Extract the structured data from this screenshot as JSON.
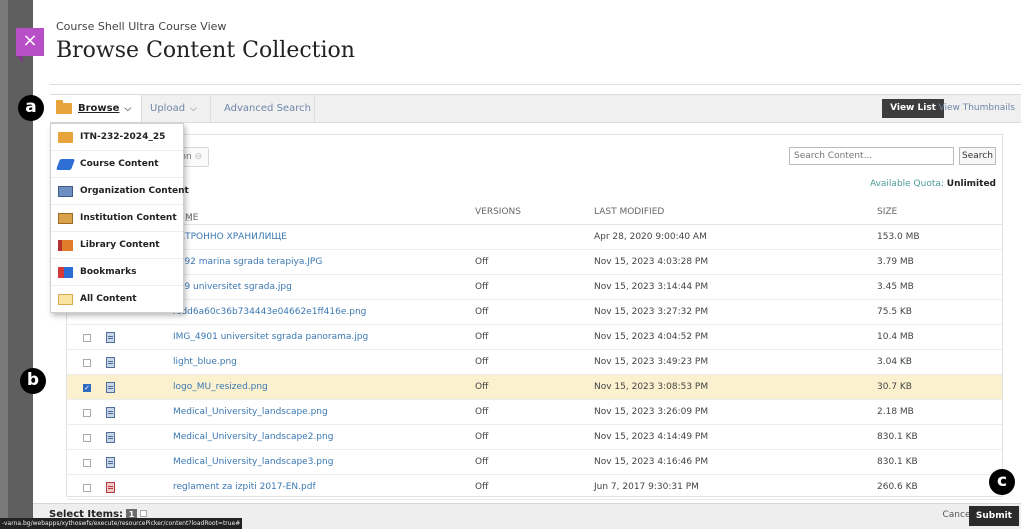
{
  "header": {
    "breadcrumb": "Course Shell Ultra Course View",
    "title": "Browse Content Collection",
    "close_glyph": "×"
  },
  "toolbar": {
    "browse_label": "Browse",
    "upload_label": "Upload",
    "advanced_search_label": "Advanced Search",
    "view_list_label": "View List",
    "view_thumbnails_label": "View Thumbnails"
  },
  "browse_menu": {
    "items": [
      {
        "label": "ITN-232-2024_25",
        "icon": "folder-icon"
      },
      {
        "label": "Course Content",
        "icon": "course-content-icon"
      },
      {
        "label": "Organization Content",
        "icon": "organization-content-icon"
      },
      {
        "label": "Institution Content",
        "icon": "institution-content-icon"
      },
      {
        "label": "Library Content",
        "icon": "library-content-icon"
      },
      {
        "label": "Bookmarks",
        "icon": "bookmarks-icon"
      },
      {
        "label": "All Content",
        "icon": "all-content-icon"
      }
    ]
  },
  "panel": {
    "collection_tab_fragment": "ition",
    "search_placeholder": "Search Content...",
    "search_button": "Search",
    "quota_label": "Available Quota:",
    "quota_value": "Unlimited",
    "columns": {
      "name": "ME",
      "name_sort_glyph": "△",
      "versions": "VERSIONS",
      "last_modified": "LAST MODIFIED",
      "size": "SIZE"
    },
    "rows": [
      {
        "name": "ЕКТРОННО ХРАНИЛИЩЕ",
        "versions": "",
        "modified": "Apr 28, 2020 9:00:40 AM",
        "size": "153.0 MB"
      },
      {
        "name": "7992 marina sgrada terapiya.JPG",
        "versions": "Off",
        "modified": "Nov 15, 2023 4:03:28 PM",
        "size": "3.79 MB"
      },
      {
        "name": "759 universitet sgrada.jpg",
        "versions": "Off",
        "modified": "Nov 15, 2023 3:14:44 PM",
        "size": "3.45 MB"
      },
      {
        "name": "rcdd6a60c36b734443e04662e1ff416e.png",
        "versions": "Off",
        "modified": "Nov 15, 2023 3:27:32 PM",
        "size": "75.5 KB"
      },
      {
        "name": "IMG_4901 universitet sgrada panorama.jpg",
        "versions": "Off",
        "modified": "Nov 15, 2023 4:04:52 PM",
        "size": "10.4 MB"
      },
      {
        "name": "light_blue.png",
        "versions": "Off",
        "modified": "Nov 15, 2023 3:49:23 PM",
        "size": "3.04 KB"
      },
      {
        "name": "logo_MU_resized.png",
        "versions": "Off",
        "modified": "Nov 15, 2023 3:08:53 PM",
        "size": "30.7 KB"
      },
      {
        "name": "Medical_University_landscape.png",
        "versions": "Off",
        "modified": "Nov 15, 2023 3:26:09 PM",
        "size": "2.18 MB"
      },
      {
        "name": "Medical_University_landscape2.png",
        "versions": "Off",
        "modified": "Nov 15, 2023 4:14:49 PM",
        "size": "830.1 KB"
      },
      {
        "name": "Medical_University_landscape3.png",
        "versions": "Off",
        "modified": "Nov 15, 2023 4:16:46 PM",
        "size": "830.1 KB"
      },
      {
        "name": "reglament za izpiti 2017-EN.pdf",
        "versions": "Off",
        "modified": "Jun 7, 2017 9:30:31 PM",
        "size": "260.6 KB"
      }
    ]
  },
  "footer": {
    "select_items_label": "Select Items:",
    "select_count": "1",
    "cancel_label": "Cancel",
    "submit_label": "Submit",
    "status_url": "-varna.bg/webapps/xythoswfs/execute/resourcePicker/content?loadRoot=true#"
  },
  "markers": {
    "a": "a",
    "b": "b",
    "c": "c"
  },
  "colors": {
    "close_tab": "#b84fc8",
    "link": "#3b78b3",
    "selected_row": "#fbf1cf",
    "view_list_bg": "#3d3d3d"
  }
}
